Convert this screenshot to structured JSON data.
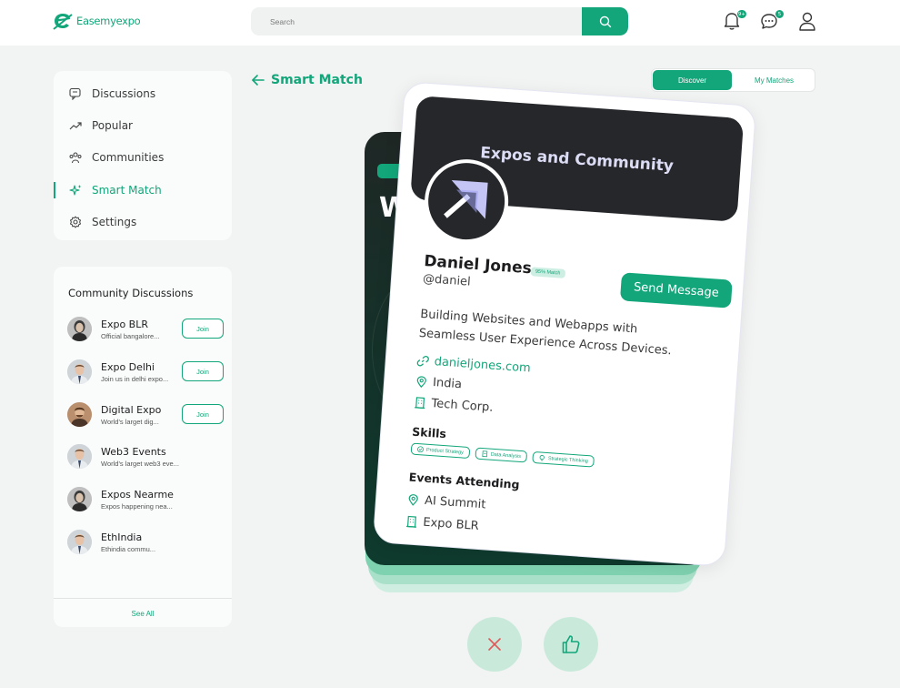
{
  "app": {
    "logo_text": "Easemyexpo"
  },
  "search": {
    "placeholder": "Search"
  },
  "notifications": {
    "bell_count": "9+",
    "chat_count": "5"
  },
  "nav": {
    "items": [
      {
        "label": "Discussions"
      },
      {
        "label": "Popular"
      },
      {
        "label": "Communities"
      },
      {
        "label": "Smart Match"
      },
      {
        "label": "Settings"
      }
    ]
  },
  "community": {
    "title": "Community Discussions",
    "items": [
      {
        "name": "Expo BLR",
        "sub": "Official bangalore...",
        "join": "Join"
      },
      {
        "name": "Expo Delhi",
        "sub": "Join us in delhi expo...",
        "join": "Join"
      },
      {
        "name": "Digital Expo",
        "sub": "World's larget dig...",
        "join": "Join"
      },
      {
        "name": "Web3 Events",
        "sub": "World's larget web3 eve..."
      },
      {
        "name": "Expos Nearme",
        "sub": "Expos happening nea..."
      },
      {
        "name": "EthIndia",
        "sub": "Ethindia commu..."
      }
    ],
    "see_all": "See All"
  },
  "page": {
    "title": "Smart Match"
  },
  "toggle": {
    "discover": "Discover",
    "my_matches": "My Matches"
  },
  "card": {
    "banner_title": "Expos and Community",
    "name": "Daniel Jones",
    "match": "95% Match",
    "handle": "@daniel",
    "send_message": "Send Message",
    "bio_line1": "Building Websites and Webapps with",
    "bio_line2": "Seamless User Experience Across Devices.",
    "website": "danieljones.com",
    "location": "India",
    "company": "Tech Corp.",
    "skills_title": "Skills",
    "skills": [
      "Product Strategy",
      "Data Analysis",
      "Strategic Thinking"
    ],
    "events_title": "Events Attending",
    "events": [
      "AI Summit",
      "Expo BLR"
    ]
  },
  "back_card": {
    "initial": "W"
  },
  "colors": {
    "accent": "#12a67a",
    "dark": "#26272b",
    "mint": "#c9eadb"
  }
}
